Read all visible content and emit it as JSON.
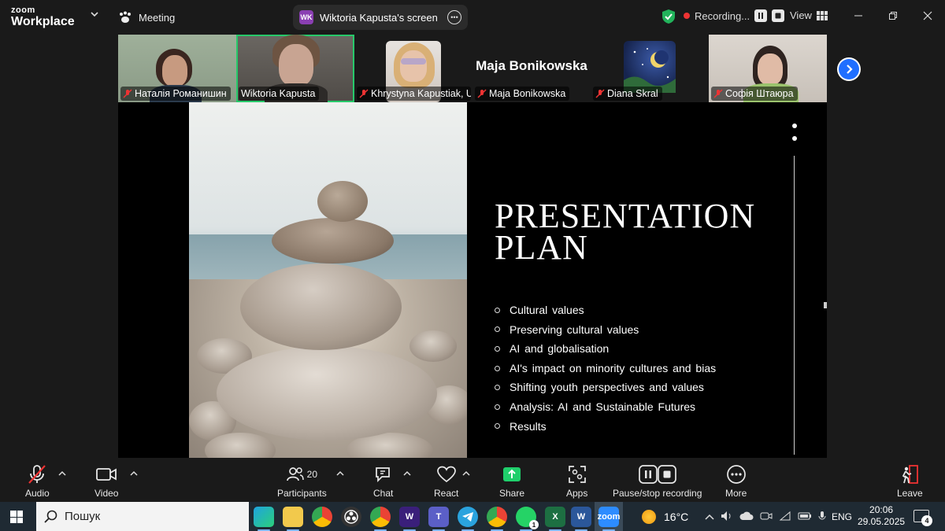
{
  "titlebar": {
    "brand_top": "zoom",
    "brand_bottom": "Workplace",
    "meeting_label": "Meeting",
    "screen_badge": "WK",
    "screen_label": "Wiktoria Kapusta's screen",
    "recording_label": "Recording...",
    "view_label": "View"
  },
  "participants": [
    {
      "name": "Наталія Романишин",
      "muted": true
    },
    {
      "name": "Wiktoria Kapusta",
      "muted": false,
      "active": true
    },
    {
      "name": "Khrystyna Kapustiak, U...",
      "muted": true
    },
    {
      "name": "Maja Bonikowska",
      "muted": true,
      "display_name": "Maja Bonikowska"
    },
    {
      "name": "Diana Skral",
      "muted": true
    },
    {
      "name": "Софія Штаюра",
      "muted": true
    }
  ],
  "slide": {
    "title_line1": "PRESENTATION",
    "title_line2": "PLAN",
    "items": [
      "Cultural values",
      "Preserving cultural values",
      "AI and globalisation",
      "AI's impact on minority cultures and bias",
      "Shifting youth perspectives and values",
      "Analysis: AI and Sustainable Futures",
      "Results"
    ]
  },
  "toolbar": {
    "audio": "Audio",
    "video": "Video",
    "participants": "Participants",
    "participant_count": "20",
    "chat": "Chat",
    "react": "React",
    "share": "Share",
    "apps": "Apps",
    "pause_recording": "Pause/stop recording",
    "more": "More",
    "leave": "Leave"
  },
  "taskbar": {
    "search_text": "Пошук",
    "weather": "16°C",
    "language": "ENG",
    "time": "20:06",
    "date": "29.05.2025",
    "notifications": "4",
    "whatsapp_badge": "1"
  },
  "colors": {
    "accent_green": "#27c96a",
    "share_green": "#1fcf6b",
    "zoom_blue": "#2d8cff",
    "record_red": "#e33333"
  }
}
